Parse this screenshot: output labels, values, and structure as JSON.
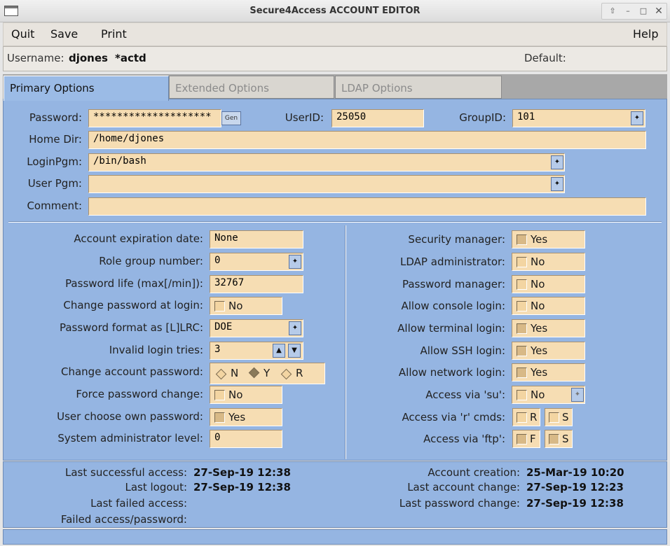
{
  "window": {
    "title": "Secure4Access ACCOUNT EDITOR"
  },
  "menu": {
    "quit": "Quit",
    "save": "Save",
    "print": "Print",
    "help": "Help"
  },
  "user": {
    "username_label": "Username:",
    "username": "djones",
    "status": "*actd",
    "default_label": "Default:",
    "default_value": ""
  },
  "tabs": [
    {
      "label": "Primary Options"
    },
    {
      "label": "Extended Options"
    },
    {
      "label": "LDAP Options"
    }
  ],
  "top": {
    "password_label": "Password:",
    "password": "********************",
    "gen_label": "Gen",
    "userid_label": "UserID:",
    "userid": "25050",
    "groupid_label": "GroupID:",
    "groupid": "101",
    "homedir_label": "Home Dir:",
    "homedir": "/home/djones",
    "loginpgm_label": "LoginPgm:",
    "loginpgm": "/bin/bash",
    "userpgm_label": "User Pgm:",
    "userpgm": "",
    "comment_label": "Comment:",
    "comment": ""
  },
  "left": {
    "expiration_label": "Account expiration date:",
    "expiration": "None",
    "rolegroup_label": "Role group number:",
    "rolegroup": "0",
    "pwlife_label": "Password life (max[/min]):",
    "pwlife": "32767",
    "changepw_label": "Change password at login:",
    "changepw": "No",
    "pwformat_label": "Password format as [L]LRC:",
    "pwformat": "DOE",
    "invalid_label": "Invalid login tries:",
    "invalid": "3",
    "changeacct_label": "Change account password:",
    "changeacct_options": [
      "N",
      "Y",
      "R"
    ],
    "changeacct_selected": "Y",
    "forcepw_label": "Force password change:",
    "forcepw": "No",
    "userchoose_label": "User choose own password:",
    "userchoose": "Yes",
    "sysadmin_label": "System administrator level:",
    "sysadmin": "0"
  },
  "right": {
    "secmgr_label": "Security manager:",
    "secmgr": "Yes",
    "ldapadmin_label": "LDAP administrator:",
    "ldapadmin": "No",
    "pwmgr_label": "Password manager:",
    "pwmgr": "No",
    "console_label": "Allow console login:",
    "console": "No",
    "terminal_label": "Allow terminal login:",
    "terminal": "Yes",
    "ssh_label": "Allow SSH login:",
    "ssh": "Yes",
    "network_label": "Allow network login:",
    "network": "Yes",
    "su_label": "Access via 'su':",
    "su": "No",
    "rcmds_label": "Access via 'r' cmds:",
    "rcmds_r": "R",
    "rcmds_s": "S",
    "ftp_label": "Access via 'ftp':",
    "ftp_f": "F",
    "ftp_s": "S"
  },
  "status": {
    "last_success_label": "Last successful access:",
    "last_success": "27-Sep-19 12:38",
    "last_logout_label": "Last logout:",
    "last_logout": "27-Sep-19 12:38",
    "last_failed_label": "Last failed access:",
    "last_failed": "",
    "failed_pw_label": "Failed access/password:",
    "failed_pw": "",
    "creation_label": "Account creation:",
    "creation": "25-Mar-19 10:20",
    "last_change_label": "Last account change:",
    "last_change": "27-Sep-19 12:23",
    "last_pw_change_label": "Last password change:",
    "last_pw_change": "27-Sep-19 12:38"
  }
}
